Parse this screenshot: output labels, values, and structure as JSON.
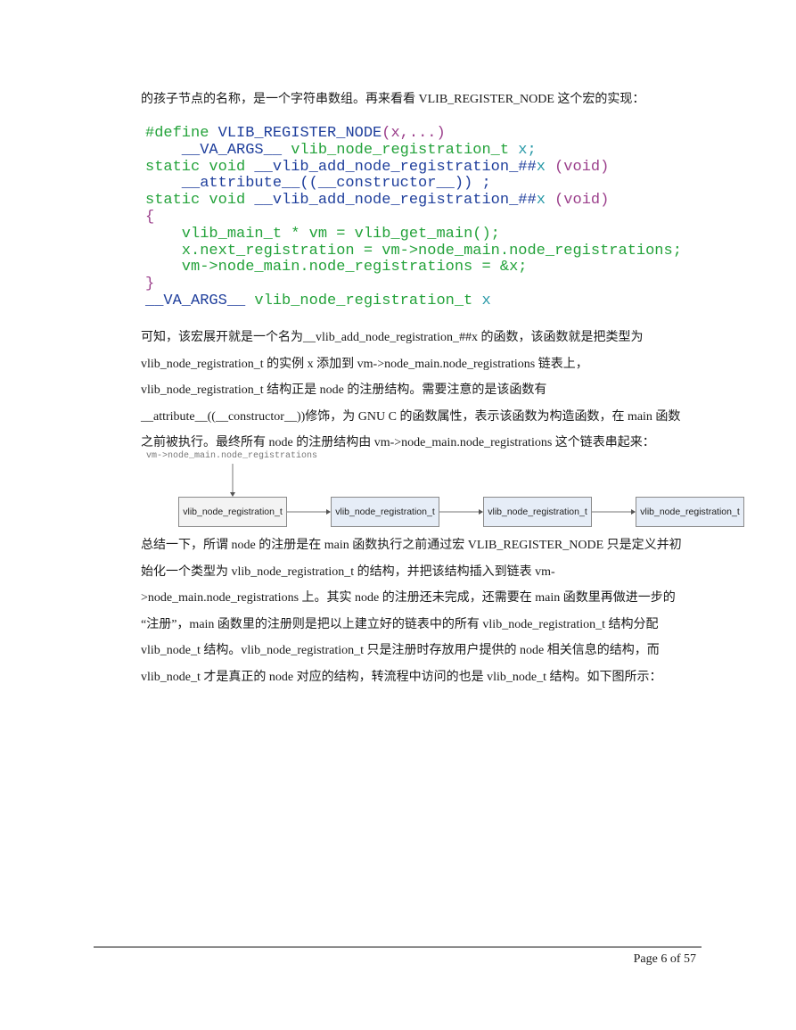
{
  "intro": "的孩子节点的名称，是一个字符串数组。再来看看 VLIB_REGISTER_NODE 这个宏的实现：",
  "code": {
    "lines": [
      [
        {
          "t": "#define ",
          "c": "k"
        },
        {
          "t": "VLIB_REGISTER_NODE",
          "c": "b"
        },
        {
          "t": "(x,...)",
          "c": "m"
        }
      ],
      [
        {
          "t": "    __VA_ARGS__ ",
          "c": "b"
        },
        {
          "t": "vlib_node_registration_t ",
          "c": "k"
        },
        {
          "t": "x;",
          "c": "c"
        }
      ],
      [
        {
          "t": "static void ",
          "c": "k"
        },
        {
          "t": "__vlib_add_node_registration_##",
          "c": "b"
        },
        {
          "t": "x ",
          "c": "c"
        },
        {
          "t": "(void)",
          "c": "m"
        }
      ],
      [
        {
          "t": "    __attribute__((__constructor__)) ;",
          "c": "b"
        }
      ],
      [
        {
          "t": "static void ",
          "c": "k"
        },
        {
          "t": "__vlib_add_node_registration_##",
          "c": "b"
        },
        {
          "t": "x ",
          "c": "c"
        },
        {
          "t": "(void)",
          "c": "m"
        }
      ],
      [
        {
          "t": "{",
          "c": "m"
        }
      ],
      [
        {
          "t": "    vlib_main_t * ",
          "c": "k"
        },
        {
          "t": "vm = vlib_get_main();",
          "c": "k"
        }
      ],
      [
        {
          "t": "    x.next_registration = ",
          "c": "k"
        },
        {
          "t": "vm->node_main.node_registrations;",
          "c": "k"
        }
      ],
      [
        {
          "t": "    vm->node_main.node_registrations = &x;",
          "c": "k"
        }
      ],
      [
        {
          "t": "}",
          "c": "m"
        }
      ],
      [
        {
          "t": "__VA_ARGS__ ",
          "c": "b"
        },
        {
          "t": "vlib_node_registration_t ",
          "c": "k"
        },
        {
          "t": "x",
          "c": "c"
        }
      ]
    ]
  },
  "para1": [
    "可知，该宏展开就是一个名为__vlib_add_node_registration_##x 的函数，该函数就是把类型为",
    "vlib_node_registration_t 的实例 x 添加到 vm->node_main.node_registrations 链表上，",
    "vlib_node_registration_t 结构正是 node 的注册结构。需要注意的是该函数有",
    "__attribute__((__constructor__))修饰，为 GNU C 的函数属性，表示该函数为构造函数，在 main 函数",
    "之前被执行。最终所有 node 的注册结构由 vm->node_main.node_registrations 这个链表串起来："
  ],
  "diagram": {
    "head_label": "vm->node_main.node_registrations",
    "nodes": [
      {
        "label": "vlib_node_registration_t",
        "fill": "#f3f3f3"
      },
      {
        "label": "vlib_node_registration_t",
        "fill": "#e6edf7"
      },
      {
        "label": "vlib_node_registration_t",
        "fill": "#e6edf7"
      },
      {
        "label": "vlib_node_registration_t",
        "fill": "#e6edf7"
      }
    ]
  },
  "para2": [
    "总结一下，所谓 node 的注册是在 main 函数执行之前通过宏 VLIB_REGISTER_NODE 只是定义并初",
    "始化一个类型为 vlib_node_registration_t 的结构，并把该结构插入到链表 vm-",
    ">node_main.node_registrations 上。其实 node 的注册还未完成，还需要在 main 函数里再做进一步的",
    "“注册”，main 函数里的注册则是把以上建立好的链表中的所有 vlib_node_registration_t 结构分配",
    "vlib_node_t 结构。vlib_node_registration_t 只是注册时存放用户提供的 node 相关信息的结构，而",
    "vlib_node_t 才是真正的 node 对应的结构，转流程中访问的也是 vlib_node_t 结构。如下图所示："
  ],
  "footer": {
    "page": "Page 6 of 57"
  }
}
